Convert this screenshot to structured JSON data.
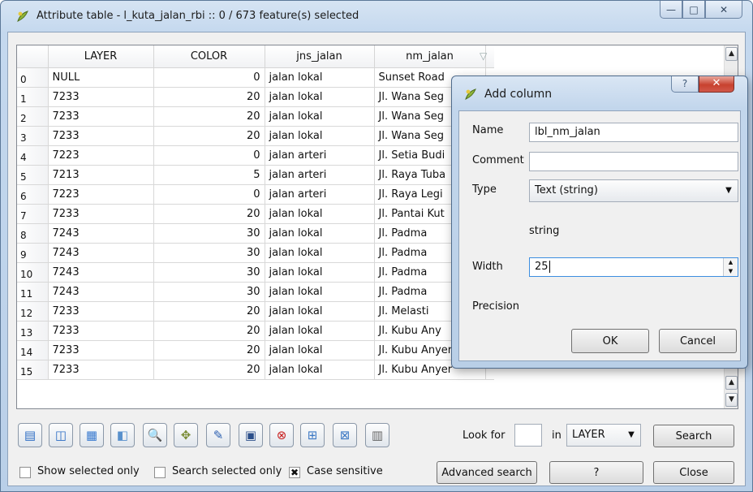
{
  "window": {
    "title": "Attribute table - l_kuta_jalan_rbi :: 0 / 673 feature(s) selected",
    "minimize": "—",
    "maximize": "□",
    "close": "✕"
  },
  "table": {
    "columns": [
      "LAYER",
      "COLOR",
      "jns_jalan",
      "nm_jalan"
    ],
    "rows": [
      {
        "n": "0",
        "layer": "NULL",
        "color": "0",
        "jns": "jalan lokal",
        "nm": "Sunset Road"
      },
      {
        "n": "1",
        "layer": "7233",
        "color": "20",
        "jns": "jalan lokal",
        "nm": "Jl. Wana Seg"
      },
      {
        "n": "2",
        "layer": "7233",
        "color": "20",
        "jns": "jalan lokal",
        "nm": "Jl. Wana Seg"
      },
      {
        "n": "3",
        "layer": "7233",
        "color": "20",
        "jns": "jalan lokal",
        "nm": "Jl. Wana Seg"
      },
      {
        "n": "4",
        "layer": "7223",
        "color": "0",
        "jns": "jalan arteri",
        "nm": "Jl. Setia Budi"
      },
      {
        "n": "5",
        "layer": "7213",
        "color": "5",
        "jns": "jalan arteri",
        "nm": "Jl. Raya Tuba"
      },
      {
        "n": "6",
        "layer": "7223",
        "color": "0",
        "jns": "jalan arteri",
        "nm": "Jl. Raya Legi"
      },
      {
        "n": "7",
        "layer": "7233",
        "color": "20",
        "jns": "jalan lokal",
        "nm": "Jl. Pantai Kut"
      },
      {
        "n": "8",
        "layer": "7243",
        "color": "30",
        "jns": "jalan lokal",
        "nm": "Jl. Padma"
      },
      {
        "n": "9",
        "layer": "7243",
        "color": "30",
        "jns": "jalan lokal",
        "nm": "Jl. Padma"
      },
      {
        "n": "10",
        "layer": "7243",
        "color": "30",
        "jns": "jalan lokal",
        "nm": "Jl. Padma"
      },
      {
        "n": "11",
        "layer": "7243",
        "color": "30",
        "jns": "jalan lokal",
        "nm": "Jl. Padma"
      },
      {
        "n": "12",
        "layer": "7233",
        "color": "20",
        "jns": "jalan lokal",
        "nm": "Jl. Melasti"
      },
      {
        "n": "13",
        "layer": "7233",
        "color": "20",
        "jns": "jalan lokal",
        "nm": "Jl. Kubu Any"
      },
      {
        "n": "14",
        "layer": "7233",
        "color": "20",
        "jns": "jalan lokal",
        "nm": "Jl. Kubu Anyer"
      },
      {
        "n": "15",
        "layer": "7233",
        "color": "20",
        "jns": "jalan lokal",
        "nm": "Jl. Kubu Anyer"
      }
    ]
  },
  "toolbar": {
    "icons": [
      "table-icon",
      "zoom-selected-icon",
      "selection-icon",
      "invert-icon",
      "search-icon",
      "pan-icon",
      "edit-pencil-icon",
      "save-icon",
      "delete-icon",
      "new-column-icon",
      "delete-column-icon",
      "calculator-icon"
    ],
    "look_for_label": "Look for",
    "look_for_value": "",
    "in_label": "in",
    "field_value": "LAYER",
    "search_button": "Search"
  },
  "footer": {
    "show_selected_only": "Show selected only",
    "search_selected_only": "Search selected only",
    "case_sensitive": "Case sensitive",
    "case_sensitive_checked": "✖",
    "advanced_search": "Advanced search",
    "help": "?",
    "close": "Close"
  },
  "dialog": {
    "title": "Add column",
    "help": "?",
    "close": "✕",
    "name_label": "Name",
    "name_value": "lbl_nm_jalan",
    "comment_label": "Comment",
    "comment_value": "",
    "type_label": "Type",
    "type_value": "Text (string)",
    "type_hint": "string",
    "width_label": "Width",
    "width_value": "25",
    "precision_label": "Precision",
    "ok": "OK",
    "cancel": "Cancel"
  }
}
